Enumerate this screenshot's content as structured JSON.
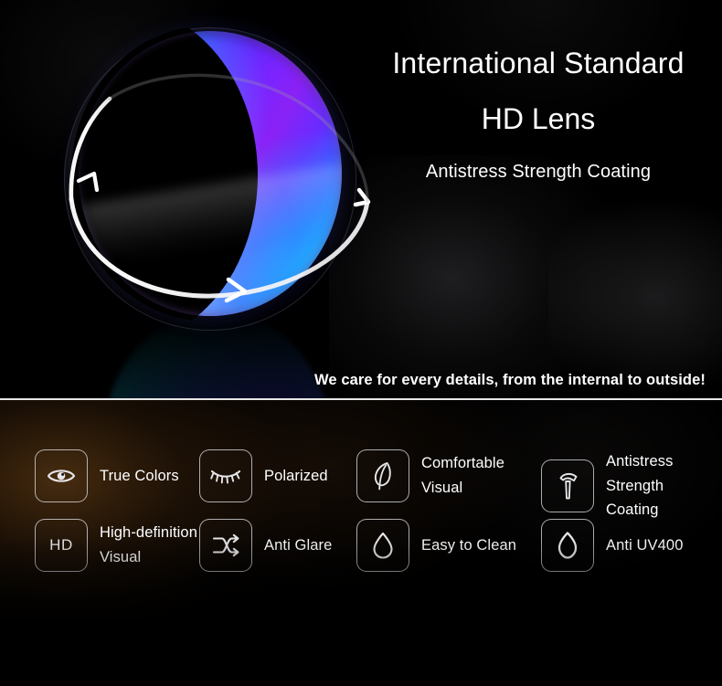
{
  "hero": {
    "title_line1": "International Standard",
    "title_line2": "HD Lens",
    "subtitle": "Antistress Strength Coating",
    "tagline": "We care for every details, from the internal to outside!",
    "lens_graphic": {
      "icon": "lens-disc-graphic",
      "orbit_icon": "orbit-ring-arrows-icon",
      "gradient_colors": [
        "#15b6ee",
        "#2f86ff",
        "#3a3cff",
        "#7a24ff",
        "#8a22f5"
      ],
      "background": "#000000"
    }
  },
  "divider": {
    "color": "#e8e8e8"
  },
  "features": {
    "background": "#000000",
    "accent_glow": "#965c1e",
    "icon_border": "#d6d6d8",
    "text_color": "#ffffff",
    "items": [
      {
        "icon": "eye-icon",
        "label_lines": [
          "True Colors"
        ]
      },
      {
        "icon": "eyelash-icon",
        "label_lines": [
          "Polarized"
        ]
      },
      {
        "icon": "feather-icon",
        "label_lines": [
          "Comfortable",
          "Visual"
        ]
      },
      {
        "icon": "hammer-icon",
        "label_lines": [
          "Antistress",
          "Strength",
          "Coating"
        ]
      },
      {
        "icon": "hd-text-icon",
        "icon_text": "HD",
        "label_lines": [
          "High-definition",
          "Visual"
        ]
      },
      {
        "icon": "shuffle-arrows-icon",
        "label_lines": [
          "Anti Glare"
        ]
      },
      {
        "icon": "water-drop-icon",
        "label_lines": [
          "Easy to Clean"
        ]
      },
      {
        "icon": "shield-icon",
        "label_lines": [
          "Anti UV400"
        ]
      }
    ]
  }
}
